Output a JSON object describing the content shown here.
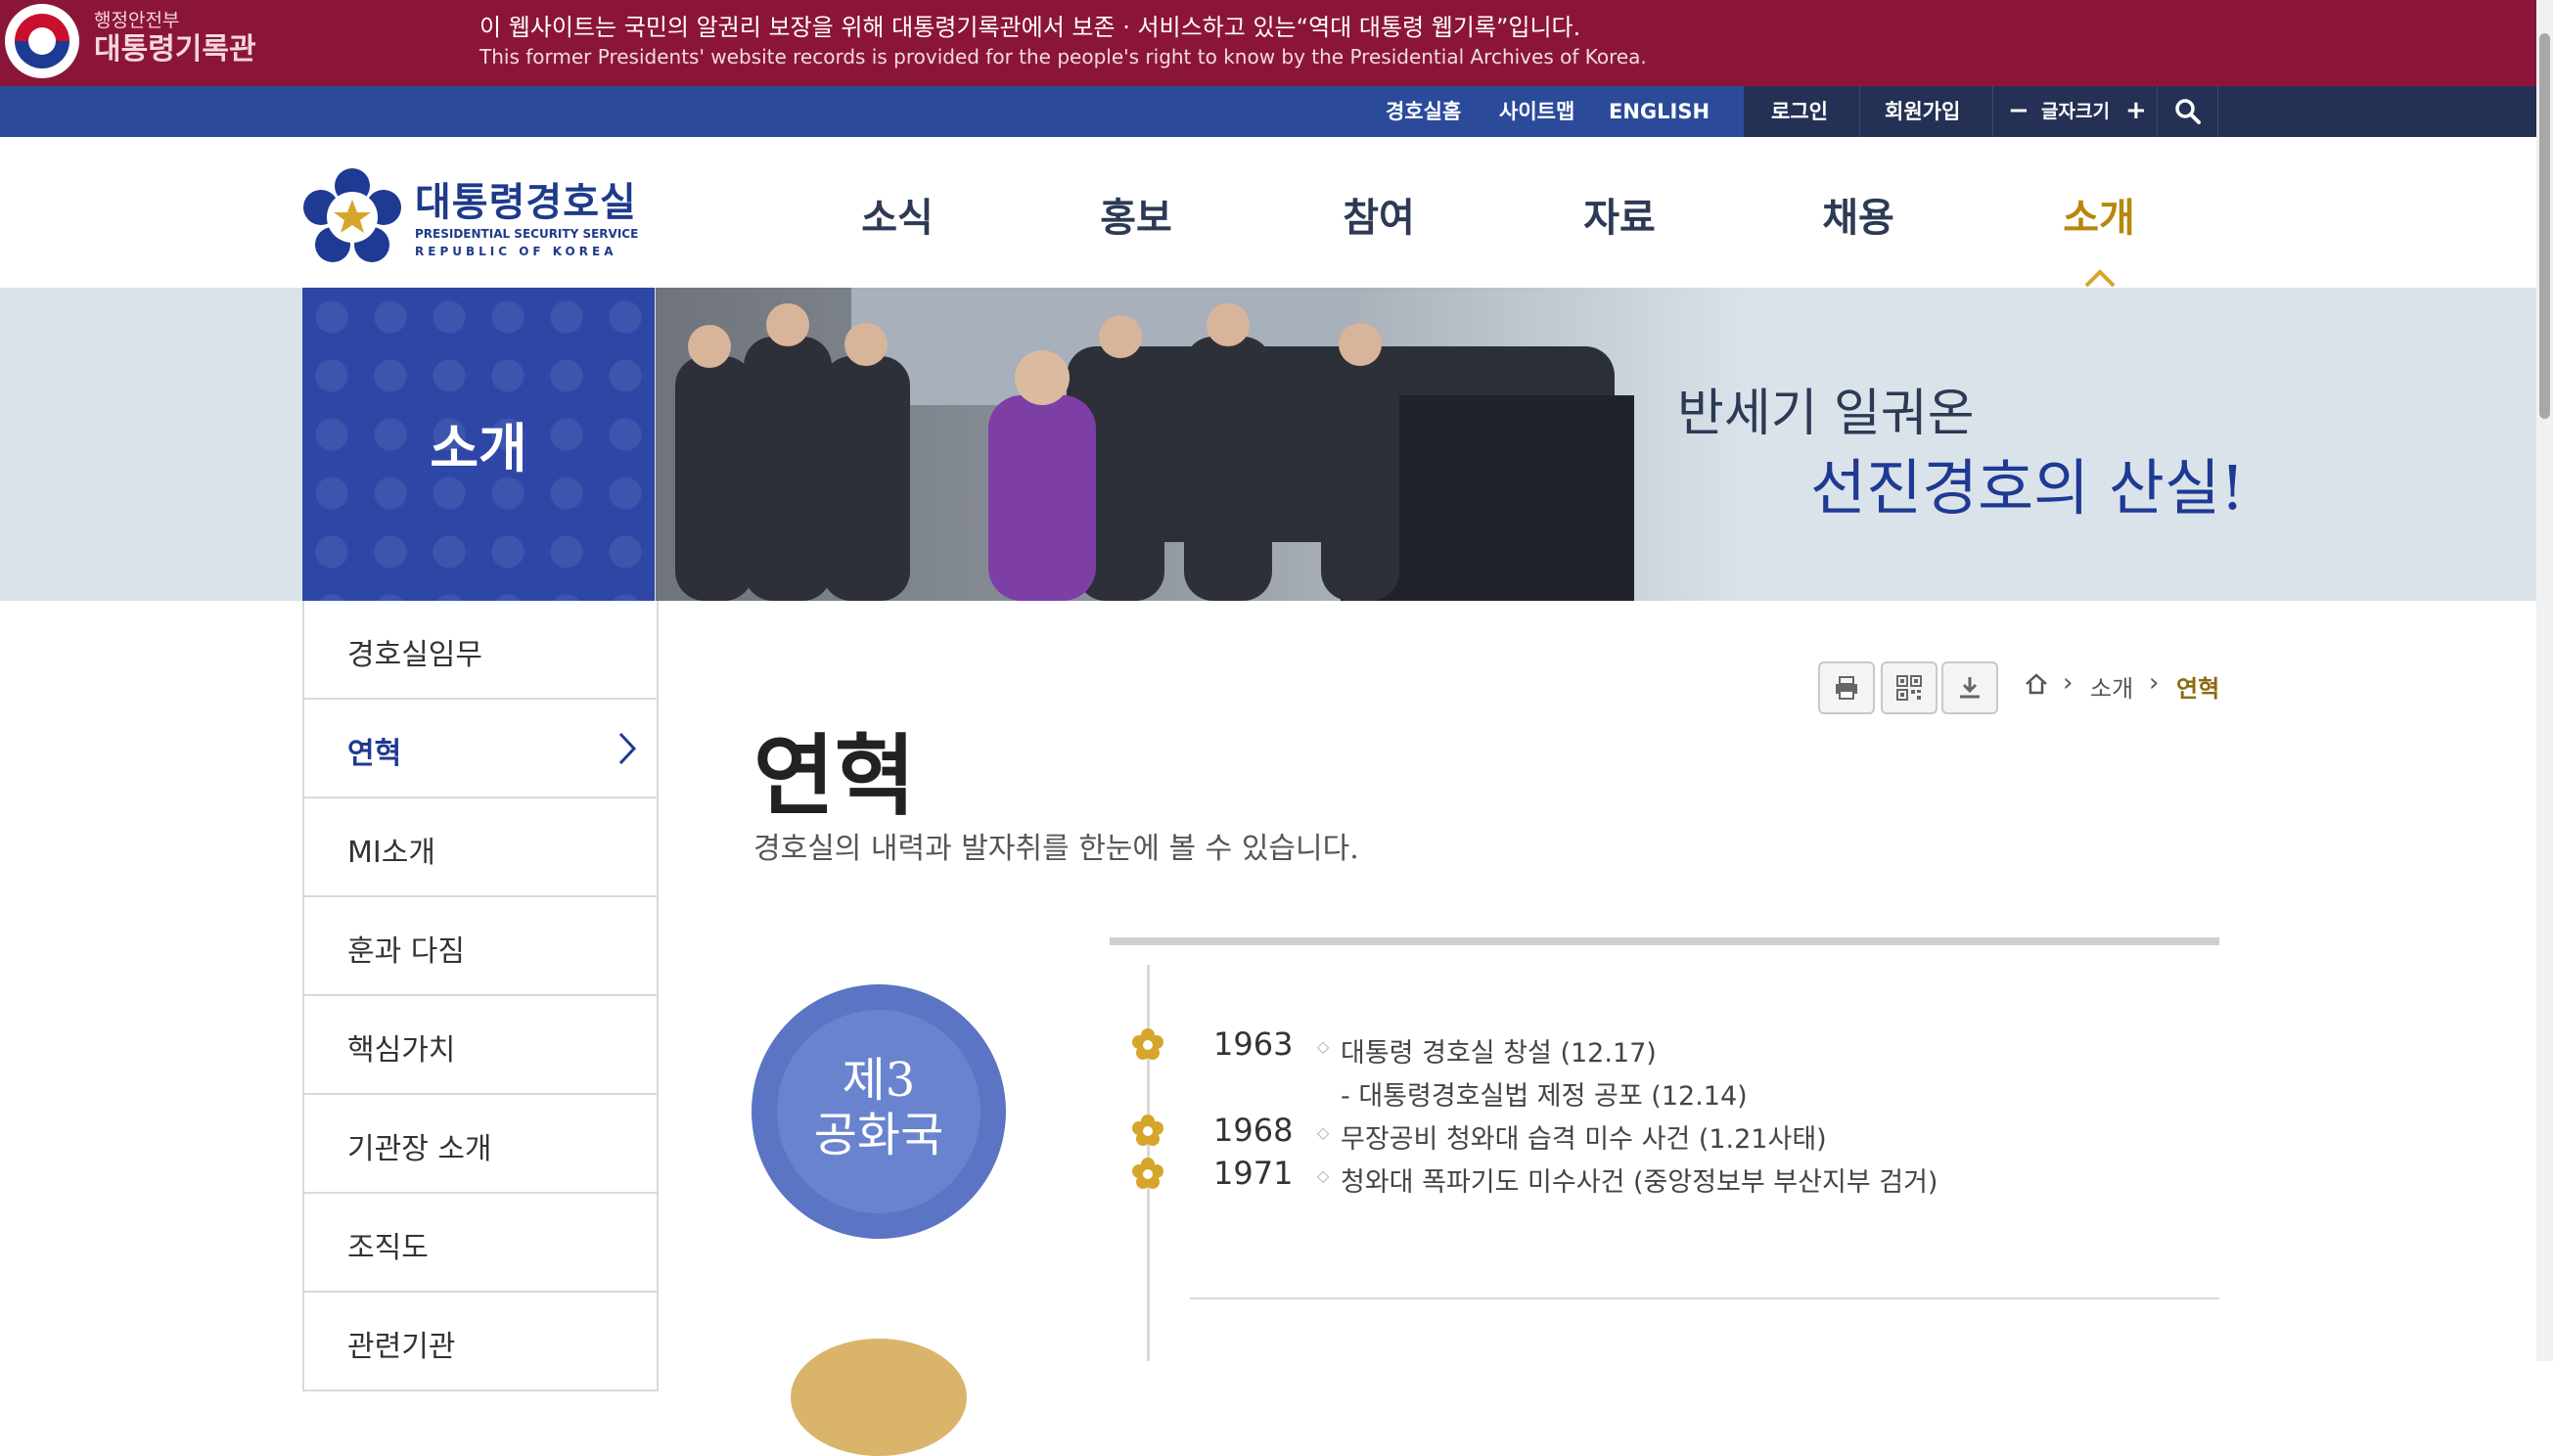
{
  "archive": {
    "org_small": "행정안전부",
    "org_name": "대통령기록관",
    "notice_ko": "이 웹사이트는 국민의 알권리 보장을 위해 대통령기록관에서 보존 · 서비스하고 있는“역대 대통령 웹기록”입니다.",
    "notice_en": "This former Presidents' website records is provided for the people's right to know by the Presidential Archives of Korea."
  },
  "util": {
    "links": [
      "경호실홈",
      "사이트맵",
      "ENGLISH"
    ],
    "login": "로그인",
    "join": "회원가입",
    "font_label": "글자크기",
    "font_minus": "−",
    "font_plus": "+"
  },
  "logo": {
    "name_ko": "대통령경호실",
    "name_en1": "PRESIDENTIAL SECURITY SERVICE",
    "name_en2": "REPUBLIC OF KOREA"
  },
  "gnb": [
    "소식",
    "홍보",
    "참여",
    "자료",
    "채용",
    "소개"
  ],
  "visual": {
    "section_title": "소개",
    "slogan_line1": "반세기 일궈온",
    "slogan_line2": "선진경호의 산실!"
  },
  "lnb": [
    "경호실임무",
    "연혁",
    "MI소개",
    "훈과 다짐",
    "핵심가치",
    "기관장 소개",
    "조직도",
    "관련기관"
  ],
  "breadcrumb": [
    "소개",
    "연혁"
  ],
  "page": {
    "title": "연혁",
    "description": "경호실의 내력과 발자취를 한눈에 볼 수 있습니다."
  },
  "era": {
    "line1": "제3",
    "line2": "공화국"
  },
  "timeline": [
    {
      "year": "1963",
      "events": [
        "대통령 경호실 창설 (12.17)",
        "- 대통령경호실법 제정 공포 (12.14)"
      ]
    },
    {
      "year": "1968",
      "events": [
        "무장공비 청와대 습격 미수 사건 (1.21사태)"
      ]
    },
    {
      "year": "1971",
      "events": [
        "청와대 폭파기도 미수사건 (중앙정보부 부산지부 검거)"
      ]
    }
  ],
  "colors": {
    "archive_bar": "#8b1538",
    "util_bar": "#2b4a9a",
    "brand_blue": "#1f3a93",
    "accent_gold": "#b8860b"
  }
}
